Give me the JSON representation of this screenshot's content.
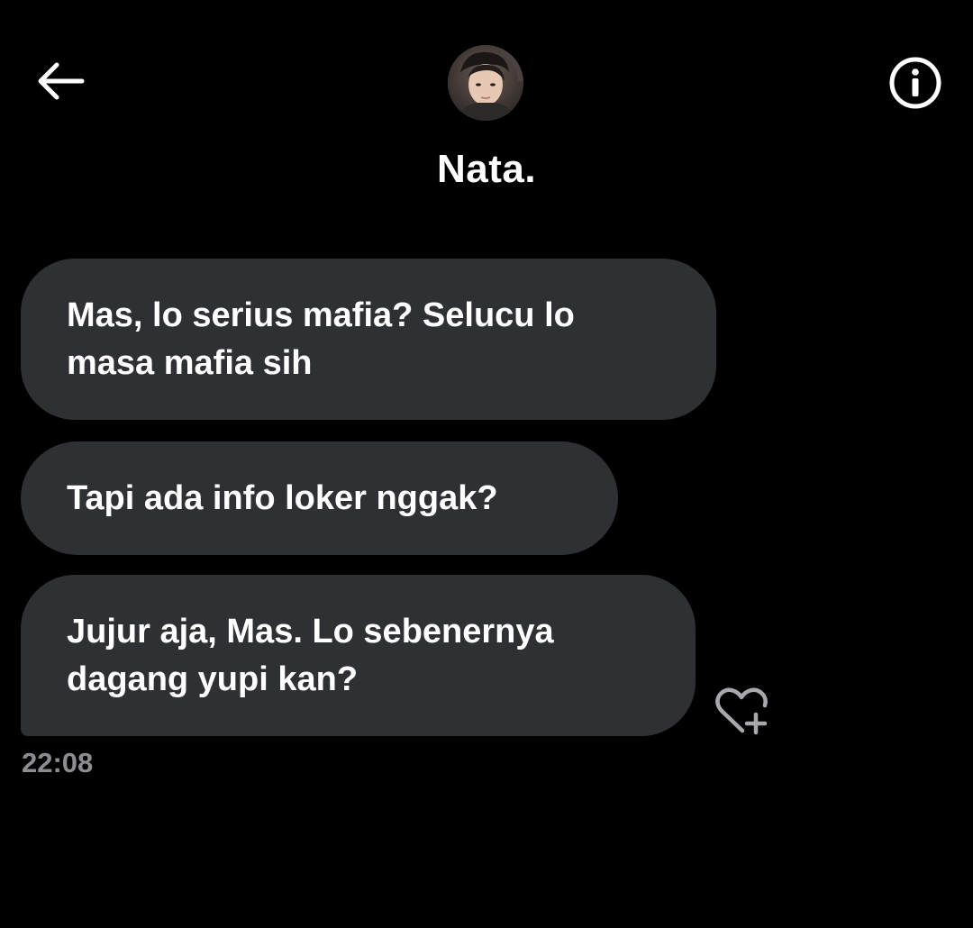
{
  "header": {
    "back_icon": "arrow-left-icon",
    "info_icon": "info-circle-icon",
    "contact_name": "Nata.",
    "avatar_alt": "Nata."
  },
  "messages": [
    {
      "text": "Mas, lo serius mafia? Selucu lo\nmasa mafia sih"
    },
    {
      "text": "Tapi ada info loker nggak?"
    },
    {
      "text": "Jujur aja, Mas. Lo sebenernya\ndagang yupi kan?"
    }
  ],
  "reaction_icon": "heart-plus-icon",
  "timestamp": "22:08",
  "colors": {
    "background": "#000000",
    "bubble": "#2f3033",
    "text": "#ffffff",
    "muted": "#8b8d91",
    "icon": "#ffffff",
    "reaction_icon": "#a7a9ad"
  }
}
